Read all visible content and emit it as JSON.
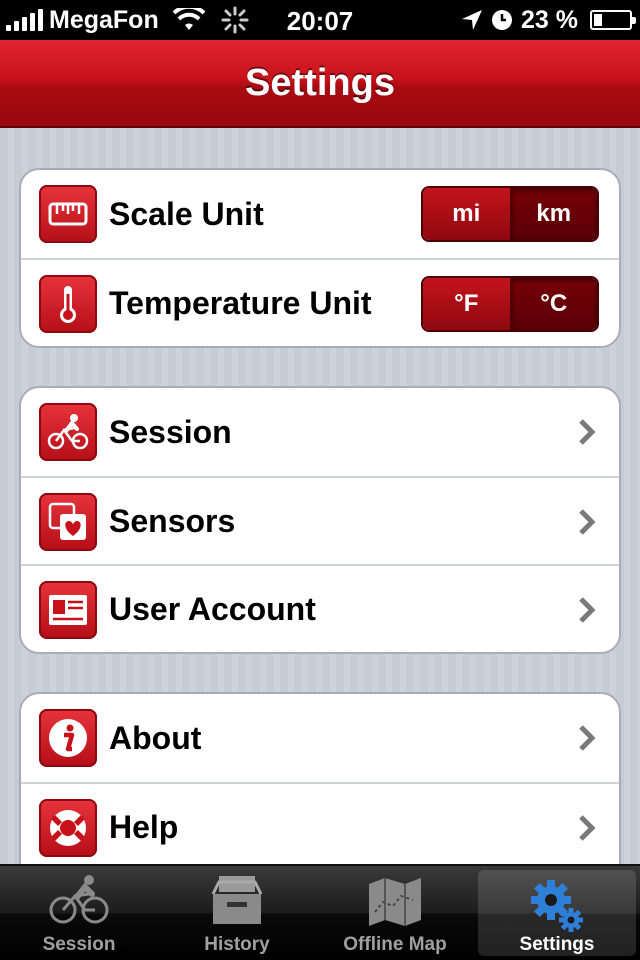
{
  "status_bar": {
    "carrier": "MegaFon",
    "time": "20:07",
    "battery": "23 %",
    "battery_level": 0.23
  },
  "nav": {
    "title": "Settings"
  },
  "units_group": {
    "scale": {
      "label": "Scale Unit",
      "icon": "ruler-icon",
      "options": [
        "mi",
        "km"
      ],
      "selected": "km"
    },
    "temperature": {
      "label": "Temperature Unit",
      "icon": "thermometer-icon",
      "options": [
        "°F",
        "°C"
      ],
      "selected": "°C"
    }
  },
  "account_group": [
    {
      "label": "Session",
      "icon": "cyclist-icon"
    },
    {
      "label": "Sensors",
      "icon": "heart-sensor-icon"
    },
    {
      "label": "User Account",
      "icon": "id-card-icon"
    }
  ],
  "info_group": [
    {
      "label": "About",
      "icon": "info-icon"
    },
    {
      "label": "Help",
      "icon": "lifebuoy-icon"
    }
  ],
  "tab_bar": {
    "tabs": [
      {
        "label": "Session",
        "icon": "cyclist-icon"
      },
      {
        "label": "History",
        "icon": "tray-icon"
      },
      {
        "label": "Offline Map",
        "icon": "map-icon"
      },
      {
        "label": "Settings",
        "icon": "gears-icon"
      }
    ],
    "selected": "Settings"
  },
  "colors": {
    "accent_red": "#c8121b",
    "tab_active_blue": "#2e7fd8"
  }
}
